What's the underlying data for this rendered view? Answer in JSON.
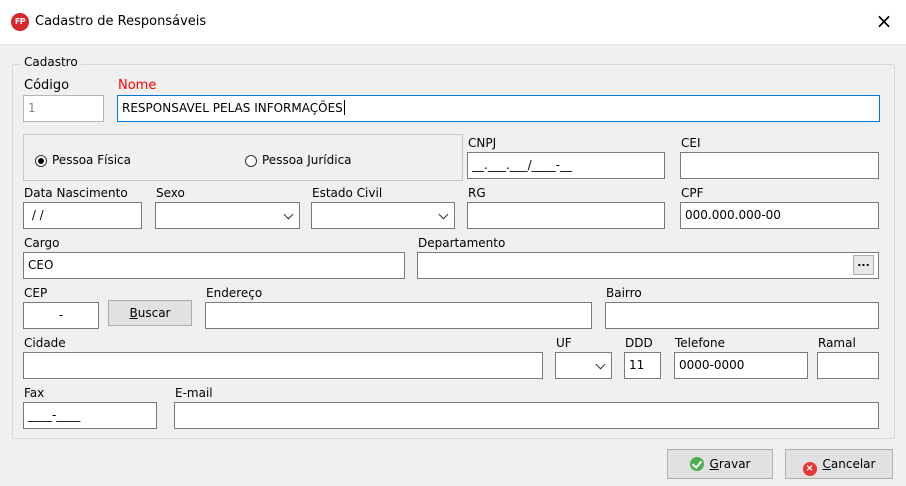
{
  "window": {
    "app_icon": "FP",
    "title": "Cadastro de Responsáveis",
    "close": "×"
  },
  "group": {
    "legend": "Cadastro"
  },
  "fields": {
    "codigo": {
      "label": "Código",
      "value": "1"
    },
    "nome": {
      "label": "Nome",
      "value": "RESPONSAVEL PELAS INFORMAÇÕES"
    },
    "pessoa": {
      "options": [
        "Pessoa Física",
        "Pessoa Jurídica"
      ],
      "selected": "Pessoa Física"
    },
    "cnpj": {
      "label": "CNPJ",
      "value": "__.___.___/____-__"
    },
    "cei": {
      "label": "CEI",
      "value": ""
    },
    "data_nascimento": {
      "label": "Data Nascimento",
      "value": " / /"
    },
    "sexo": {
      "label": "Sexo",
      "value": ""
    },
    "estado_civil": {
      "label": "Estado Civil",
      "value": ""
    },
    "rg": {
      "label": "RG",
      "value": ""
    },
    "cpf": {
      "label": "CPF",
      "value": "000.000.000-00"
    },
    "cargo": {
      "label": "Cargo",
      "value": "CEO"
    },
    "departamento": {
      "label": "Departamento",
      "value": "",
      "button": "..."
    },
    "cep": {
      "label": "CEP",
      "value": "-"
    },
    "buscar": {
      "label_pre": "",
      "label_ul": "B",
      "label_post": "uscar"
    },
    "endereco": {
      "label": "Endereço",
      "value": ""
    },
    "bairro": {
      "label": "Bairro",
      "value": ""
    },
    "cidade": {
      "label": "Cidade",
      "value": ""
    },
    "uf": {
      "label": "UF",
      "value": ""
    },
    "ddd": {
      "label": "DDD",
      "value": "11"
    },
    "telefone": {
      "label": "Telefone",
      "value": "0000-0000"
    },
    "ramal": {
      "label": "Ramal",
      "value": ""
    },
    "fax": {
      "label": "Fax",
      "value": "____-____"
    },
    "email": {
      "label": "E-mail",
      "value": ""
    }
  },
  "buttons": {
    "gravar": {
      "ul": "G",
      "rest": "ravar",
      "icon": "check-circle-icon",
      "color": "#4caf50"
    },
    "cancelar": {
      "ul": "C",
      "rest": "ancelar",
      "icon": "cancel-circle-icon",
      "color": "#e53935"
    }
  }
}
